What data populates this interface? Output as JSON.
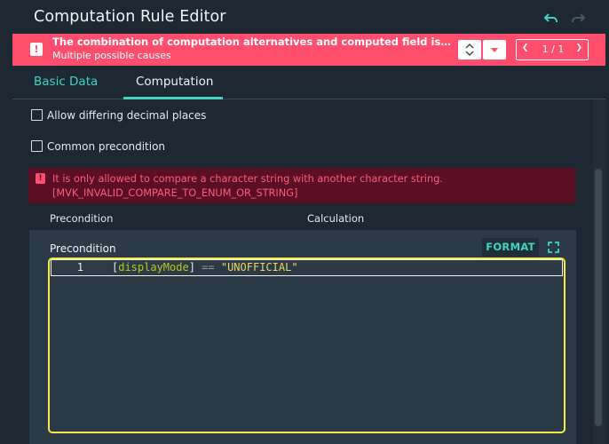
{
  "window": {
    "title": "Computation Rule Editor"
  },
  "banner": {
    "title": "The combination of computation alternatives and computed field is not valid",
    "subtitle": "Multiple possible causes",
    "icon": "!",
    "pager": "1 / 1",
    "color": "#ff4d6d"
  },
  "tabs": [
    {
      "label": "Basic Data",
      "active": false
    },
    {
      "label": "Computation",
      "active": true
    }
  ],
  "options": {
    "allow_decimal": {
      "label": "Allow differing decimal places",
      "checked": false
    },
    "common_precondition": {
      "label": "Common precondition",
      "checked": false
    }
  },
  "error": {
    "icon": "!",
    "line1": "It is only allowed to compare a character string with another character string.",
    "line2": "[MVK_INVALID_COMPARE_TO_ENUM_OR_STRING]",
    "color": "#ff5c78"
  },
  "table": {
    "headers": [
      "Precondition",
      "Calculation"
    ]
  },
  "panel": {
    "title": "Precondition",
    "format_label": "FORMAT"
  },
  "editor": {
    "lines": [
      {
        "number": "1",
        "open_bracket": "[",
        "field": "displayMode",
        "close_bracket": "]",
        "operator": " == ",
        "string": "\"UNOFFICIAL\""
      }
    ]
  },
  "colors": {
    "accent": "#3ed6c3",
    "background": "#1d2833",
    "highlight_border": "#f4ea4a"
  }
}
